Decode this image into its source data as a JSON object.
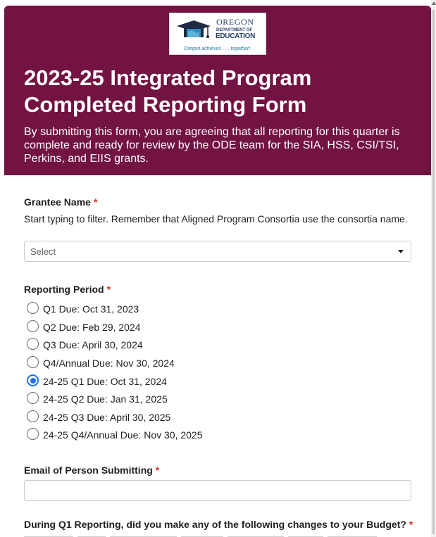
{
  "header": {
    "logo": {
      "line1": "OREGON",
      "line2": "DEPARTMENT OF",
      "line3": "EDUCATION",
      "tagline": "Oregon achieves . . . together!"
    },
    "title": "2023-25 Integrated Program Completed Reporting Form",
    "subtitle": "By submitting this form, you are agreeing that all reporting for this quarter is complete and ready for review by the ODE team for the SIA, HSS, CSI/TSI, Perkins, and EIIS grants.",
    "background_color": "#721342"
  },
  "form": {
    "required_marker": "*",
    "grantee": {
      "label": "Grantee Name",
      "help": "Start typing to filter. Remember that Aligned Program Consortia use the consortia name.",
      "placeholder": "Select"
    },
    "reporting_period": {
      "label": "Reporting Period",
      "options": [
        {
          "label": "Q1 Due: Oct 31, 2023",
          "checked": false
        },
        {
          "label": "Q2 Due: Feb 29, 2024",
          "checked": false
        },
        {
          "label": "Q3 Due: April 30, 2024",
          "checked": false
        },
        {
          "label": "Q4/Annual Due: Nov 30, 2024",
          "checked": false
        },
        {
          "label": "24-25 Q1 Due: Oct 31, 2024",
          "checked": true
        },
        {
          "label": "24-25 Q2 Due: Jan 31, 2025",
          "checked": false
        },
        {
          "label": "24-25 Q3 Due: April 30, 2025",
          "checked": false
        },
        {
          "label": "24-25 Q4/Annual Due: Nov 30, 2025",
          "checked": false
        }
      ]
    },
    "email": {
      "label": "Email of Person Submitting",
      "value": ""
    },
    "budget_changes": {
      "label": "During Q1 Reporting, did you make any of the following changes to your Budget?"
    }
  },
  "colors": {
    "accent": "#1a73e8",
    "required": "#d93025"
  }
}
